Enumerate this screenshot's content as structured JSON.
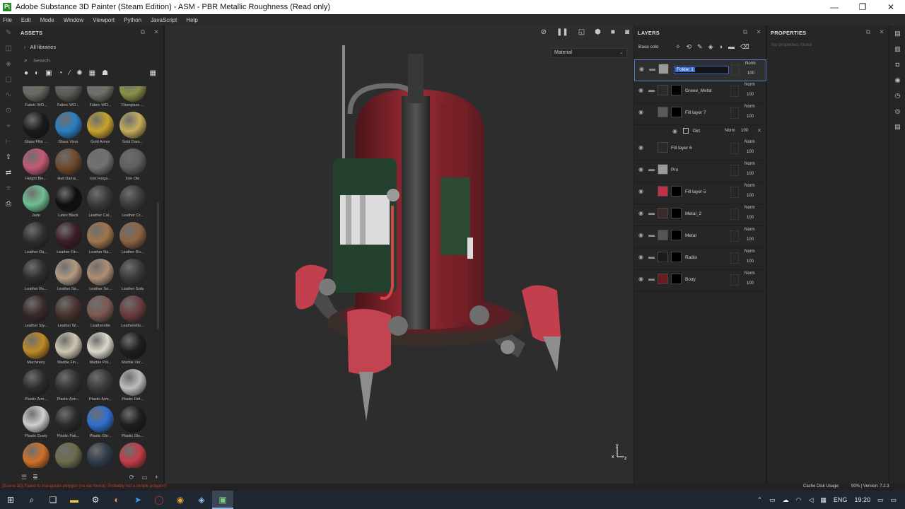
{
  "window": {
    "title": "Adobe Substance 3D Painter (Steam Edition) - ASM - PBR Metallic Roughness (Read only)",
    "app_icon": "Pt",
    "minimize": "—",
    "maximize": "❐",
    "close": "✕"
  },
  "menu": [
    "File",
    "Edit",
    "Mode",
    "Window",
    "Viewport",
    "Python",
    "JavaScript",
    "Help"
  ],
  "assets": {
    "title": "ASSETS",
    "library_label": "All libraries",
    "search_placeholder": "Search",
    "items": [
      {
        "label": "Fabric WO...",
        "color": "#6a6a62"
      },
      {
        "label": "Fabric WO...",
        "color": "#5c5c58"
      },
      {
        "label": "Fabric WO...",
        "color": "#707068"
      },
      {
        "label": "Fiberglass ...",
        "color": "#8c8f48"
      },
      {
        "label": "Glass Film ...",
        "color": "#1a1a1a"
      },
      {
        "label": "Glass Visor",
        "color": "#2a7fc0"
      },
      {
        "label": "Gold Armor",
        "color": "#c9a22c"
      },
      {
        "label": "Gold Dam...",
        "color": "#c6ad5a"
      },
      {
        "label": "Height Ble...",
        "color": "#c25a73"
      },
      {
        "label": "Hull Dama...",
        "color": "#6e4a2c"
      },
      {
        "label": "Iron Forge...",
        "color": "#707070"
      },
      {
        "label": "Iron Old",
        "color": "#5e5e5e"
      },
      {
        "label": "Jade",
        "color": "#6fbf93"
      },
      {
        "label": "Latex Black",
        "color": "#0f0f0f"
      },
      {
        "label": "Leather Cal...",
        "color": "#3a3a3a"
      },
      {
        "label": "Leather Cr...",
        "color": "#3c3c3c"
      },
      {
        "label": "Leather Da...",
        "color": "#2f2f2f"
      },
      {
        "label": "Leather Fin...",
        "color": "#3c1e26"
      },
      {
        "label": "Leather Na...",
        "color": "#a0754c"
      },
      {
        "label": "Leather Ro...",
        "color": "#8c6442"
      },
      {
        "label": "Leather Ro...",
        "color": "#2e2e2e"
      },
      {
        "label": "Leather Se...",
        "color": "#b39a82"
      },
      {
        "label": "Leather Se...",
        "color": "#ad8f75"
      },
      {
        "label": "Leather Sofa",
        "color": "#3a3a3a"
      },
      {
        "label": "Leather Sty...",
        "color": "#3a2a2a"
      },
      {
        "label": "Leather W...",
        "color": "#4a3430"
      },
      {
        "label": "Leatherette",
        "color": "#7d5a50"
      },
      {
        "label": "Leatherette...",
        "color": "#6a3c40"
      },
      {
        "label": "Machinery",
        "color": "#c08a26"
      },
      {
        "label": "Marble Fin...",
        "color": "#cfc6b2"
      },
      {
        "label": "Marble Pol...",
        "color": "#dcd8cc"
      },
      {
        "label": "Marble Ver...",
        "color": "#1e1e1e"
      },
      {
        "label": "Plastic Arm...",
        "color": "#2c2c2c"
      },
      {
        "label": "Plastic Arm...",
        "color": "#333333"
      },
      {
        "label": "Plastic Arm...",
        "color": "#3a3a3a"
      },
      {
        "label": "Plastic Dirt...",
        "color": "#bdbdbd"
      },
      {
        "label": "Plastic Dusty",
        "color": "#cfcfcf"
      },
      {
        "label": "Plastic Fak...",
        "color": "#2a2a2a"
      },
      {
        "label": "Plastic Glo...",
        "color": "#2f6fd0"
      },
      {
        "label": "Plastic Glo...",
        "color": "#1e1e1e"
      },
      {
        "label": "",
        "color": "#d0702a"
      },
      {
        "label": "",
        "color": "#6b6b4c"
      },
      {
        "label": "",
        "color": "#2e3a4c"
      },
      {
        "label": "",
        "color": "#c23c48"
      }
    ]
  },
  "viewport": {
    "material_mode": "Material"
  },
  "layers": {
    "title": "LAYERS",
    "channel": "Base colo",
    "items": [
      {
        "name": "Folder 1",
        "blend": "Norm",
        "opacity": "100",
        "selected": true,
        "folder": true,
        "thumb": "#9a9a9a",
        "mask": ""
      },
      {
        "name": "Greee_Metal",
        "blend": "Norm",
        "opacity": "100",
        "folder": true,
        "thumb": "#2b2b2b",
        "mask": "#000000"
      },
      {
        "name": "Fill layer 7",
        "blend": "Norm",
        "opacity": "100",
        "folder": false,
        "thumb": "#5a5a5a",
        "mask": "#000000"
      },
      {
        "name": "Fill layer 6",
        "blend": "Norm",
        "opacity": "100",
        "folder": false,
        "thumb": "#2a2a2a",
        "mask": ""
      },
      {
        "name": "Pro",
        "blend": "Norm",
        "opacity": "100",
        "folder": true,
        "thumb": "#9a9a9a",
        "mask": ""
      },
      {
        "name": "Fill layer 5",
        "blend": "Norm",
        "opacity": "100",
        "folder": false,
        "thumb": "#c23048",
        "mask": "#000000"
      },
      {
        "name": "Metal_2",
        "blend": "Norm",
        "opacity": "100",
        "folder": true,
        "thumb": "#3a2a2a",
        "mask": "#000000"
      },
      {
        "name": "Metal",
        "blend": "Norm",
        "opacity": "100",
        "folder": true,
        "thumb": "#555555",
        "mask": "#000000"
      },
      {
        "name": "Radio",
        "blend": "Norm",
        "opacity": "100",
        "folder": true,
        "thumb": "#1a1a1a",
        "mask": "#000000"
      },
      {
        "name": "Body",
        "blend": "Norm",
        "opacity": "100",
        "folder": true,
        "thumb": "#6a1c22",
        "mask": "#000000"
      }
    ],
    "sublayer": {
      "name": "Dirt",
      "blend": "Norm",
      "opacity": "100"
    }
  },
  "properties": {
    "title": "PROPERTIES",
    "empty_text": "No properties found"
  },
  "status": {
    "error": "[Scene 3D] Failed to triangulate polygon (no ear found). Probably not a simple polygon?",
    "cache": "Cache Disk Usage:",
    "version": "90% | Version: 7.2.3"
  },
  "taskbar": {
    "lang": "ENG",
    "time": "19:20"
  }
}
